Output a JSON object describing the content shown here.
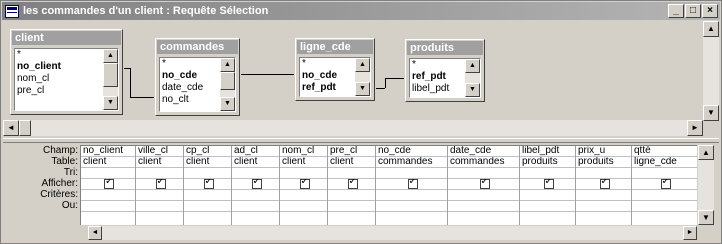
{
  "window": {
    "title": "les commandes d'un client : Requête Sélection",
    "title_icon": "query-window-icon",
    "buttons": {
      "minimize": "_",
      "maximize": "□",
      "close": "×"
    }
  },
  "tables": [
    {
      "name": "client",
      "fields": [
        "*",
        "no_client",
        "nom_cl",
        "pre_cl"
      ],
      "key_fields": [
        "no_client"
      ]
    },
    {
      "name": "commandes",
      "fields": [
        "*",
        "no_cde",
        "date_cde",
        "no_clt"
      ],
      "key_fields": [
        "no_cde"
      ]
    },
    {
      "name": "ligne_cde",
      "fields": [
        "*",
        "no_cde",
        "ref_pdt"
      ],
      "key_fields": [
        "no_cde",
        "ref_pdt"
      ]
    },
    {
      "name": "produits",
      "fields": [
        "*",
        "ref_pdt",
        "libel_pdt"
      ],
      "key_fields": [
        "ref_pdt"
      ]
    }
  ],
  "grid": {
    "row_labels": [
      "Champ:",
      "Table:",
      "Tri:",
      "Afficher:",
      "Critères:",
      "Ou:"
    ],
    "columns": [
      {
        "champ": "no_client",
        "table": "client",
        "tri": "",
        "afficher": true
      },
      {
        "champ": "ville_cl",
        "table": "client",
        "tri": "",
        "afficher": true
      },
      {
        "champ": "cp_cl",
        "table": "client",
        "tri": "",
        "afficher": true
      },
      {
        "champ": "ad_cl",
        "table": "client",
        "tri": "",
        "afficher": true
      },
      {
        "champ": "nom_cl",
        "table": "client",
        "tri": "",
        "afficher": true
      },
      {
        "champ": "pre_cl",
        "table": "client",
        "tri": "",
        "afficher": true
      },
      {
        "champ": "no_cde",
        "table": "commandes",
        "tri": "",
        "afficher": true
      },
      {
        "champ": "date_cde",
        "table": "commandes",
        "tri": "",
        "afficher": true
      },
      {
        "champ": "libel_pdt",
        "table": "produits",
        "tri": "",
        "afficher": true
      },
      {
        "champ": "prix_u",
        "table": "produits",
        "tri": "",
        "afficher": true
      },
      {
        "champ": "qtté",
        "table": "ligne_cde",
        "tri": "",
        "afficher": true
      }
    ]
  },
  "icons": {
    "scroll_up": "▲",
    "scroll_down": "▼",
    "scroll_left": "◄",
    "scroll_right": "►"
  },
  "colors": {
    "title_bar": "#808080",
    "table_title": "#a0a0a0",
    "face": "#d4d0c8"
  }
}
